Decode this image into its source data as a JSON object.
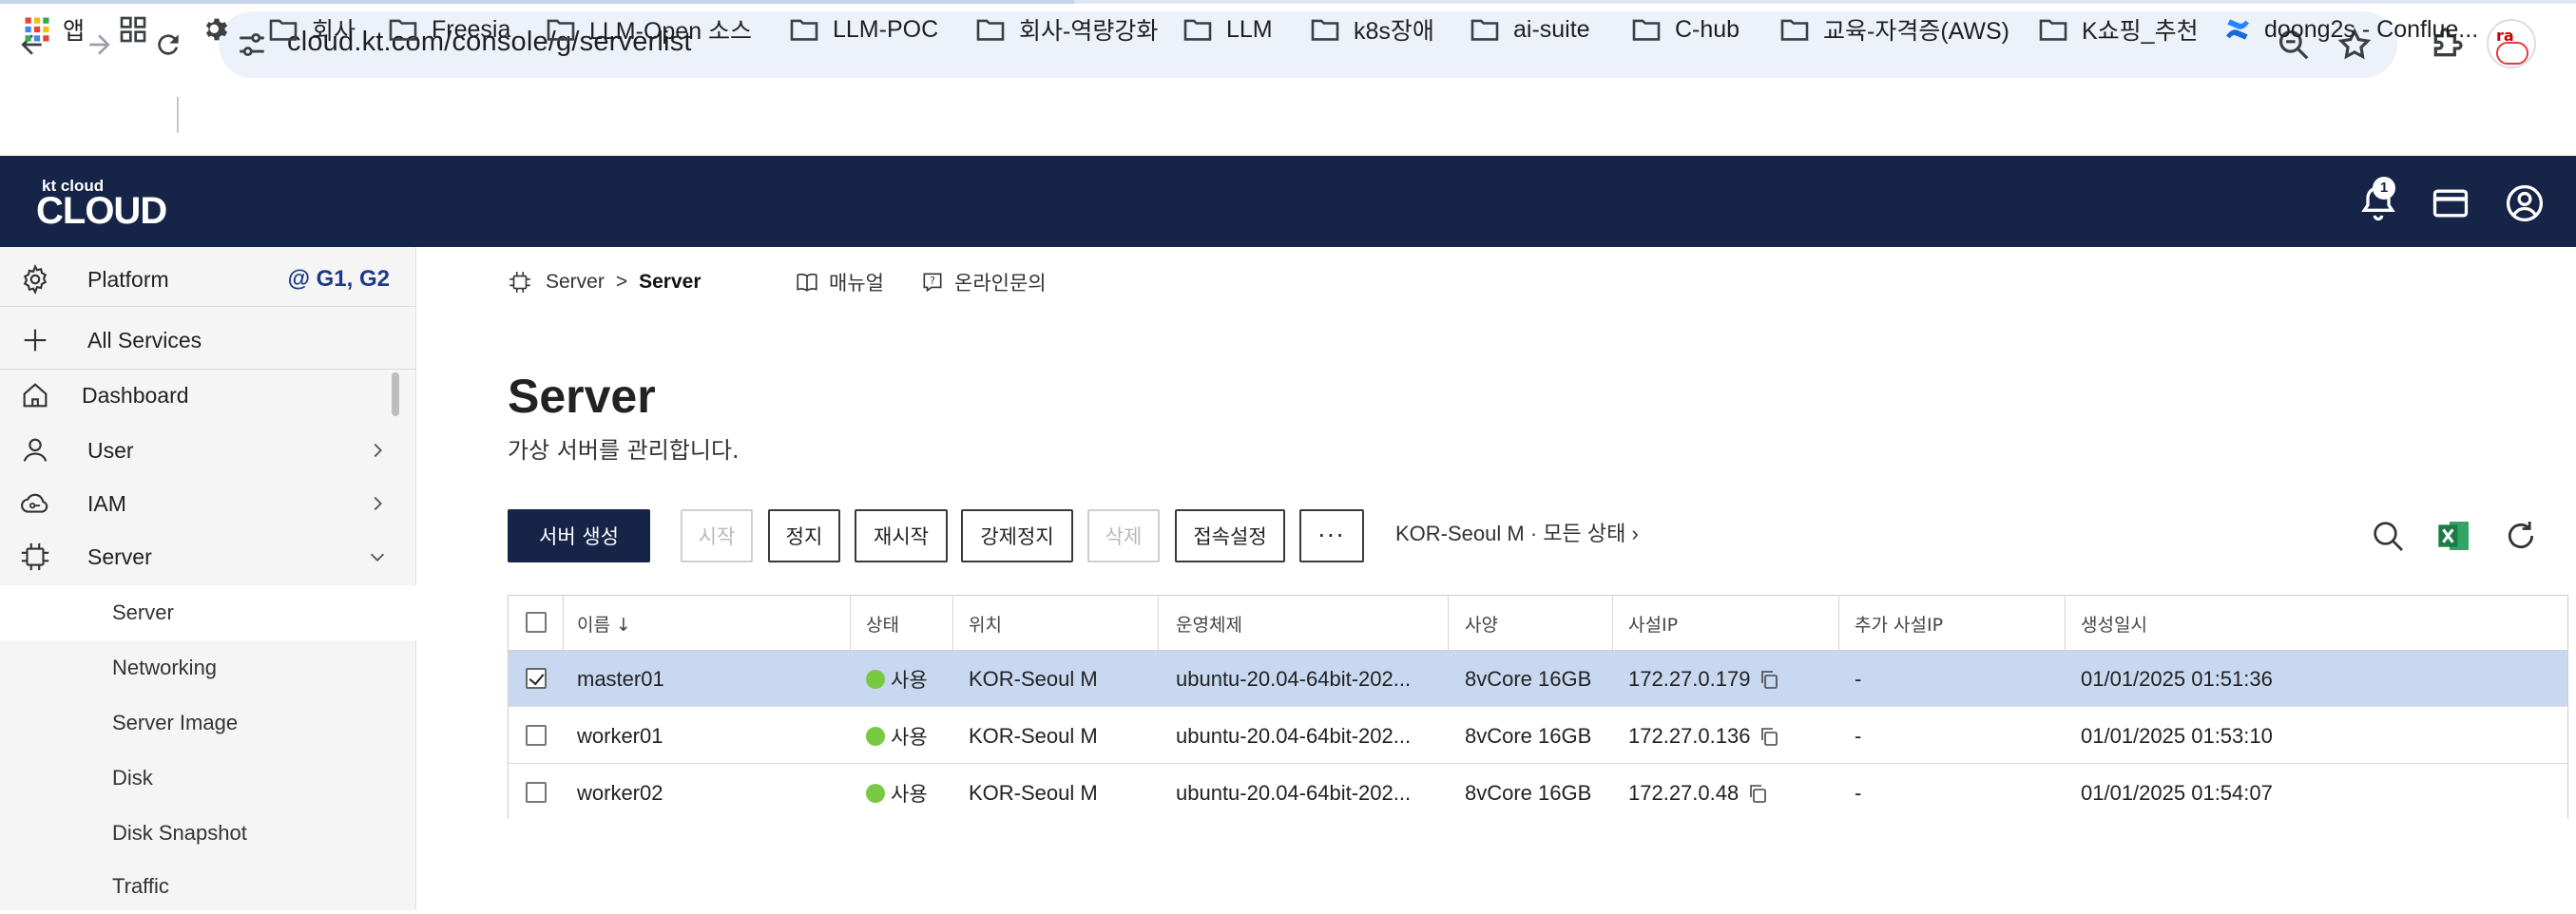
{
  "browser": {
    "url": "cloud.kt.com/console/g/serverlist",
    "bookmarks": [
      "앱",
      "회사",
      "Freesia",
      "LLM-Open 소스",
      "LLM-POC",
      "회사-역량강화",
      "LLM",
      "k8s장애",
      "ai-suite",
      "C-hub",
      "교육-자격증(AWS)",
      "K쇼핑_추천",
      "doong2s - Conflue..."
    ]
  },
  "header": {
    "logo_small": "kt cloud",
    "logo_big": "CLOUD",
    "notification_count": "1"
  },
  "sidebar": {
    "platform_label": "Platform",
    "platform_badge": "@ G1, G2",
    "items": [
      {
        "label": "All Services"
      },
      {
        "label": "Dashboard"
      },
      {
        "label": "User"
      },
      {
        "label": "IAM"
      },
      {
        "label": "Server"
      }
    ],
    "sub_items": [
      {
        "label": "Server"
      },
      {
        "label": "Networking"
      },
      {
        "label": "Server Image"
      },
      {
        "label": "Disk"
      },
      {
        "label": "Disk Snapshot"
      },
      {
        "label": "Traffic"
      }
    ]
  },
  "breadcrumb": {
    "root": "Server",
    "separator": ">",
    "current": "Server"
  },
  "top_links": {
    "manual": "매뉴얼",
    "inquiry": "온라인문의"
  },
  "page": {
    "title": "Server",
    "subtitle": "가상 서버를 관리합니다."
  },
  "toolbar": {
    "create": "서버 생성",
    "start": "시작",
    "stop": "정지",
    "restart": "재시작",
    "force_stop": "강제정지",
    "delete": "삭제",
    "access_settings": "접속설정",
    "more": "···",
    "filter": "KOR-Seoul M · 모든 상태 ›"
  },
  "table": {
    "columns": [
      "이름 ↓",
      "상태",
      "위치",
      "운영체제",
      "사양",
      "사설IP",
      "추가 사설IP",
      "생성일시"
    ],
    "rows": [
      {
        "name": "master01",
        "status": "사용",
        "location": "KOR-Seoul M",
        "os": "ubuntu-20.04-64bit-202...",
        "spec": "8vCore 16GB",
        "ip": "172.27.0.179",
        "extra_ip": "-",
        "created": "01/01/2025 01:51:36",
        "selected": true
      },
      {
        "name": "worker01",
        "status": "사용",
        "location": "KOR-Seoul M",
        "os": "ubuntu-20.04-64bit-202...",
        "spec": "8vCore 16GB",
        "ip": "172.27.0.136",
        "extra_ip": "-",
        "created": "01/01/2025 01:53:10",
        "selected": false
      },
      {
        "name": "worker02",
        "status": "사용",
        "location": "KOR-Seoul M",
        "os": "ubuntu-20.04-64bit-202...",
        "spec": "8vCore 16GB",
        "ip": "172.27.0.48",
        "extra_ip": "-",
        "created": "01/01/2025 01:54:07",
        "selected": false
      }
    ]
  },
  "colors": {
    "header_bg": "#162447",
    "selected_row": "#c7d8f0",
    "status_active": "#7ac943",
    "excel_green": "#1d7a45"
  }
}
